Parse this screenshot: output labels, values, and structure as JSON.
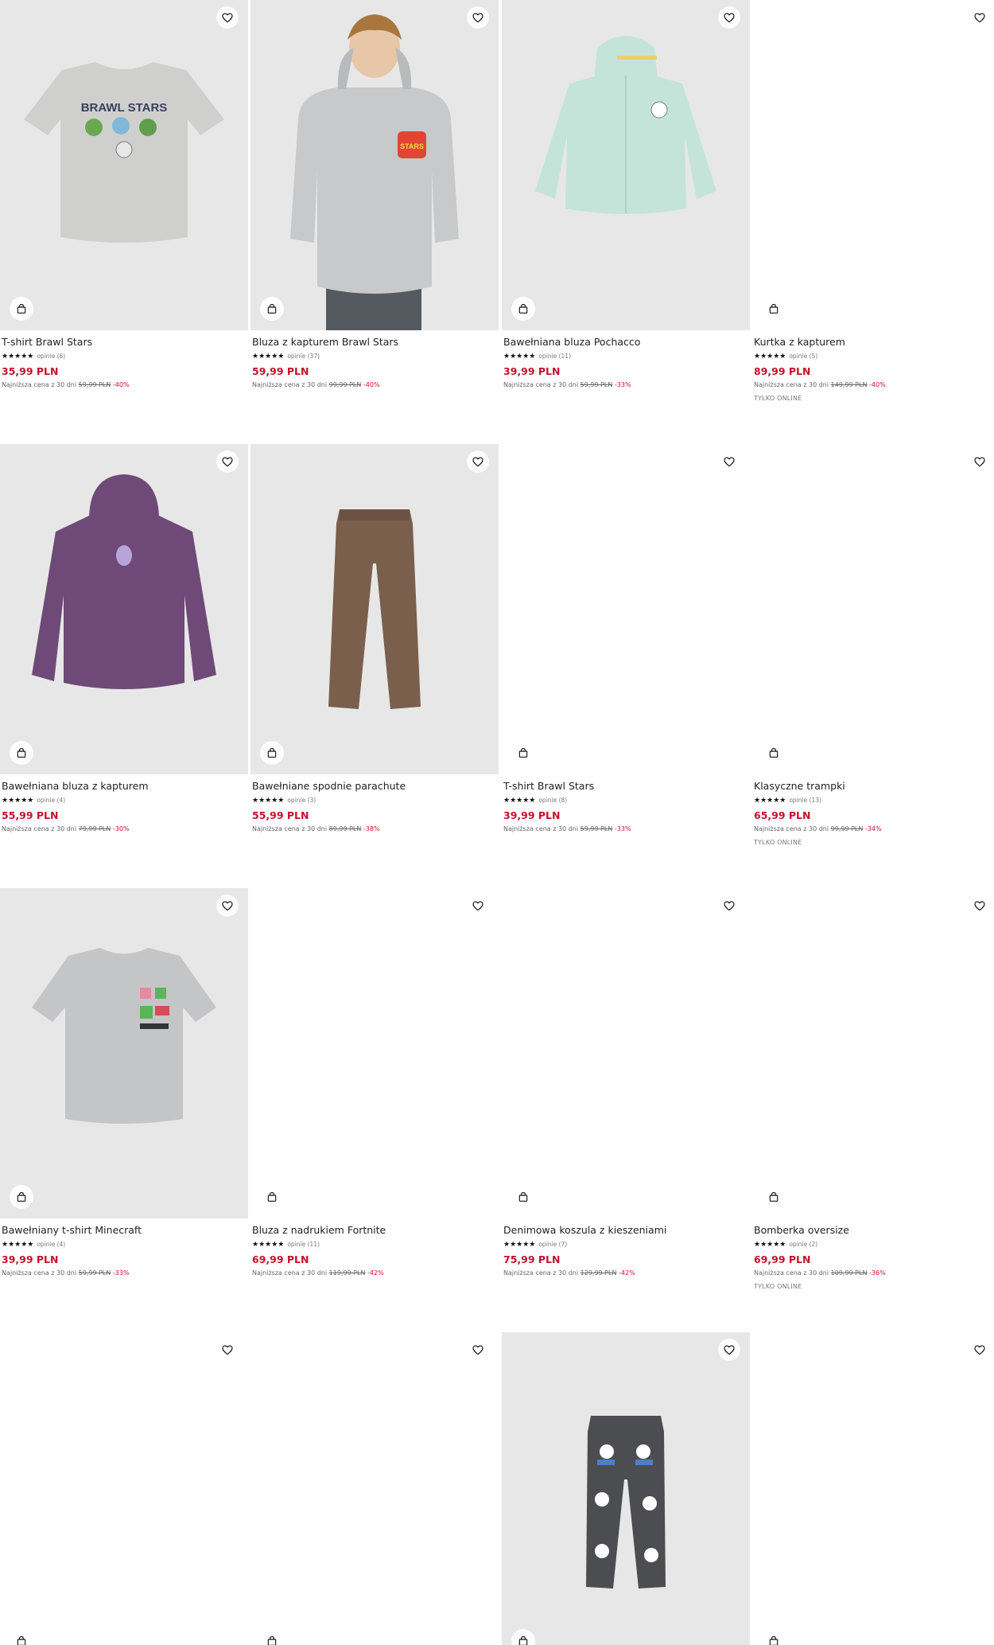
{
  "colors": {
    "price": "#c8102e",
    "photo_bg": "#e7e7e7"
  },
  "icons": {
    "favorite": "heart-icon",
    "add_to_bag": "bag-icon",
    "rating": "star-icon"
  },
  "products": [
    {
      "name": "T-shirt Brawl Stars",
      "stars": "★★★★★",
      "reviews": "opinie (6)",
      "price": "35,99 PLN",
      "lowest_label": "Najniższa cena z 30 dni",
      "old_price": "59,99 PLN",
      "discount": "-40%",
      "badge": ""
    },
    {
      "name": "Bluza z kapturem Brawl Stars",
      "stars": "★★★★★",
      "reviews": "opinie (37)",
      "price": "59,99 PLN",
      "lowest_label": "Najniższa cena z 30 dni",
      "old_price": "99,99 PLN",
      "discount": "-40%",
      "badge": ""
    },
    {
      "name": "Bawełniana bluza Pochacco",
      "stars": "★★★★★",
      "reviews": "opinie (11)",
      "price": "39,99 PLN",
      "lowest_label": "Najniższa cena z 30 dni",
      "old_price": "59,99 PLN",
      "discount": "-33%",
      "badge": ""
    },
    {
      "name": "Kurtka z kapturem",
      "stars": "★★★★★",
      "reviews": "opinie (5)",
      "price": "89,99 PLN",
      "lowest_label": "Najniższa cena z 30 dni",
      "old_price": "149,99 PLN",
      "discount": "-40%",
      "badge": "TYLKO ONLINE"
    },
    {
      "name": "Bawełniana bluza z kapturem",
      "stars": "★★★★★",
      "reviews": "opinie (4)",
      "price": "55,99 PLN",
      "lowest_label": "Najniższa cena z 30 dni",
      "old_price": "79,99 PLN",
      "discount": "-30%",
      "badge": ""
    },
    {
      "name": "Bawełniane spodnie parachute",
      "stars": "★★★★★",
      "reviews": "opinie (3)",
      "price": "55,99 PLN",
      "lowest_label": "Najniższa cena z 30 dni",
      "old_price": "89,99 PLN",
      "discount": "-38%",
      "badge": ""
    },
    {
      "name": "T-shirt Brawl Stars",
      "stars": "★★★★★",
      "reviews": "opinie (8)",
      "price": "39,99 PLN",
      "lowest_label": "Najniższa cena z 30 dni",
      "old_price": "59,99 PLN",
      "discount": "-33%",
      "badge": ""
    },
    {
      "name": "Klasyczne trampki",
      "stars": "★★★★★",
      "reviews": "opinie (13)",
      "price": "65,99 PLN",
      "lowest_label": "Najniższa cena z 30 dni",
      "old_price": "99,99 PLN",
      "discount": "-34%",
      "badge": "TYLKO ONLINE"
    },
    {
      "name": "Bawełniany t-shirt Minecraft",
      "stars": "★★★★★",
      "reviews": "opinie (4)",
      "price": "39,99 PLN",
      "lowest_label": "Najniższa cena z 30 dni",
      "old_price": "59,99 PLN",
      "discount": "-33%",
      "badge": ""
    },
    {
      "name": "Bluza z nadrukiem Fortnite",
      "stars": "★★★★★",
      "reviews": "opinie (11)",
      "price": "69,99 PLN",
      "lowest_label": "Najniższa cena z 30 dni",
      "old_price": "119,99 PLN",
      "discount": "-42%",
      "badge": ""
    },
    {
      "name": "Denimowa koszula z kieszeniami",
      "stars": "★★★★★",
      "reviews": "opinie (7)",
      "price": "75,99 PLN",
      "lowest_label": "Najniższa cena z 30 dni",
      "old_price": "129,99 PLN",
      "discount": "-42%",
      "badge": ""
    },
    {
      "name": "Bomberka oversize",
      "stars": "★★★★★",
      "reviews": "opinie (2)",
      "price": "69,99 PLN",
      "lowest_label": "Najniższa cena z 30 dni",
      "old_price": "109,99 PLN",
      "discount": "-36%",
      "badge": "TYLKO ONLINE"
    }
  ],
  "row4_images": [
    {
      "image": "blank"
    },
    {
      "image": "blank"
    },
    {
      "image": "photo"
    },
    {
      "image": "blank"
    }
  ]
}
